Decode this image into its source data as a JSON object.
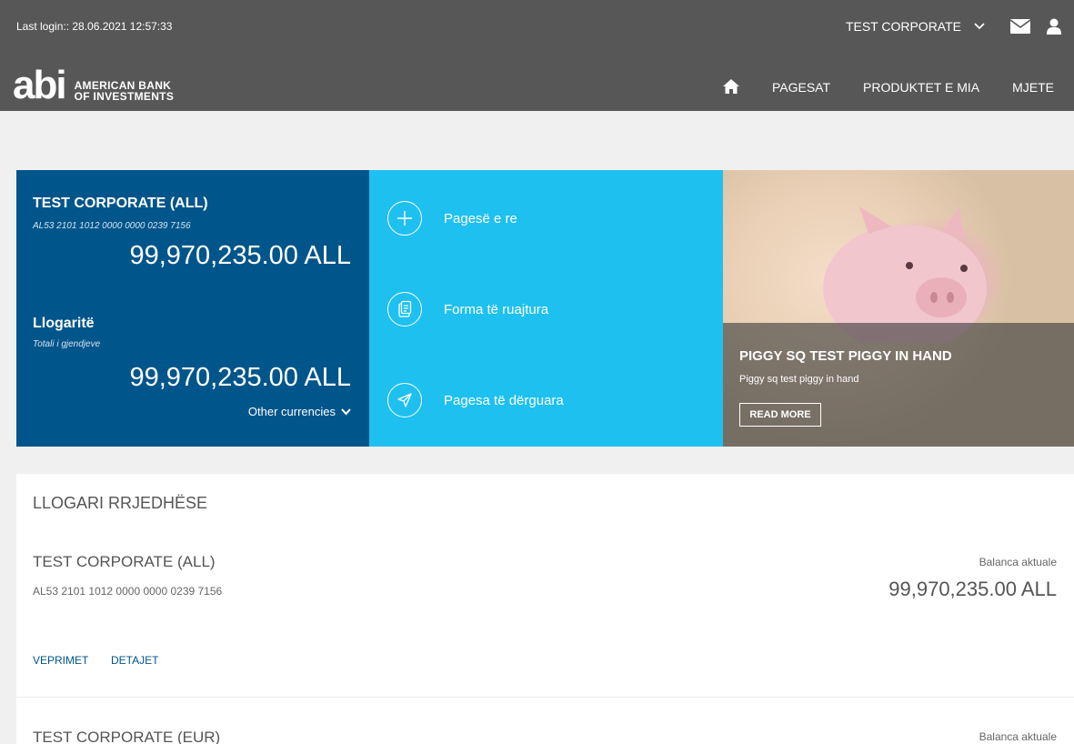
{
  "header": {
    "last_login": "Last login:: 28.06.2021 12:57:33",
    "company_selector": "TEST CORPORATE",
    "logo_mark": "abi",
    "logo_line1": "AMERICAN BANK",
    "logo_line2": "OF INVESTMENTS",
    "nav": [
      {
        "label": "PAGESAT"
      },
      {
        "label": "PRODUKTET E MIA"
      },
      {
        "label": "MJETE"
      }
    ],
    "colors": {
      "background": "#575757"
    }
  },
  "account_panel": {
    "account_name": "TEST CORPORATE (ALL)",
    "iban": "AL53 2101 1012 0000 0000 0239 7156",
    "balance": "99,970,235.00 ALL",
    "accounts_title": "Llogaritë",
    "accounts_subtitle": "Totali i gjendjeve",
    "total_balance": "99,970,235.00 ALL",
    "other_currencies": "Other currencies",
    "color": "#00558a"
  },
  "quick_actions": {
    "color": "#1ec0f0",
    "items": [
      {
        "label": "Pagesë e re",
        "icon": "plus-icon"
      },
      {
        "label": "Forma të ruajtura",
        "icon": "saved-form-icon"
      },
      {
        "label": "Pagesa të dërguara",
        "icon": "paper-plane-icon"
      }
    ]
  },
  "promo": {
    "title": "PIGGY SQ TEST PIGGY IN HAND",
    "subtitle": "Piggy sq test piggy in hand",
    "button": "READ MORE"
  },
  "accounts_list": {
    "heading": "LLOGARI RRJEDHËSE",
    "balance_label": "Balanca aktuale",
    "rows": [
      {
        "name": "TEST CORPORATE (ALL)",
        "iban": "AL53 2101 1012 0000 0000 0239 7156",
        "balance_label": "Balanca aktuale",
        "balance": "99,970,235.00 ALL",
        "link_transactions": "VEPRIMET",
        "link_details": "DETAJET"
      },
      {
        "name": "TEST CORPORATE (EUR)",
        "balance_label": "Balanca aktuale"
      }
    ]
  }
}
